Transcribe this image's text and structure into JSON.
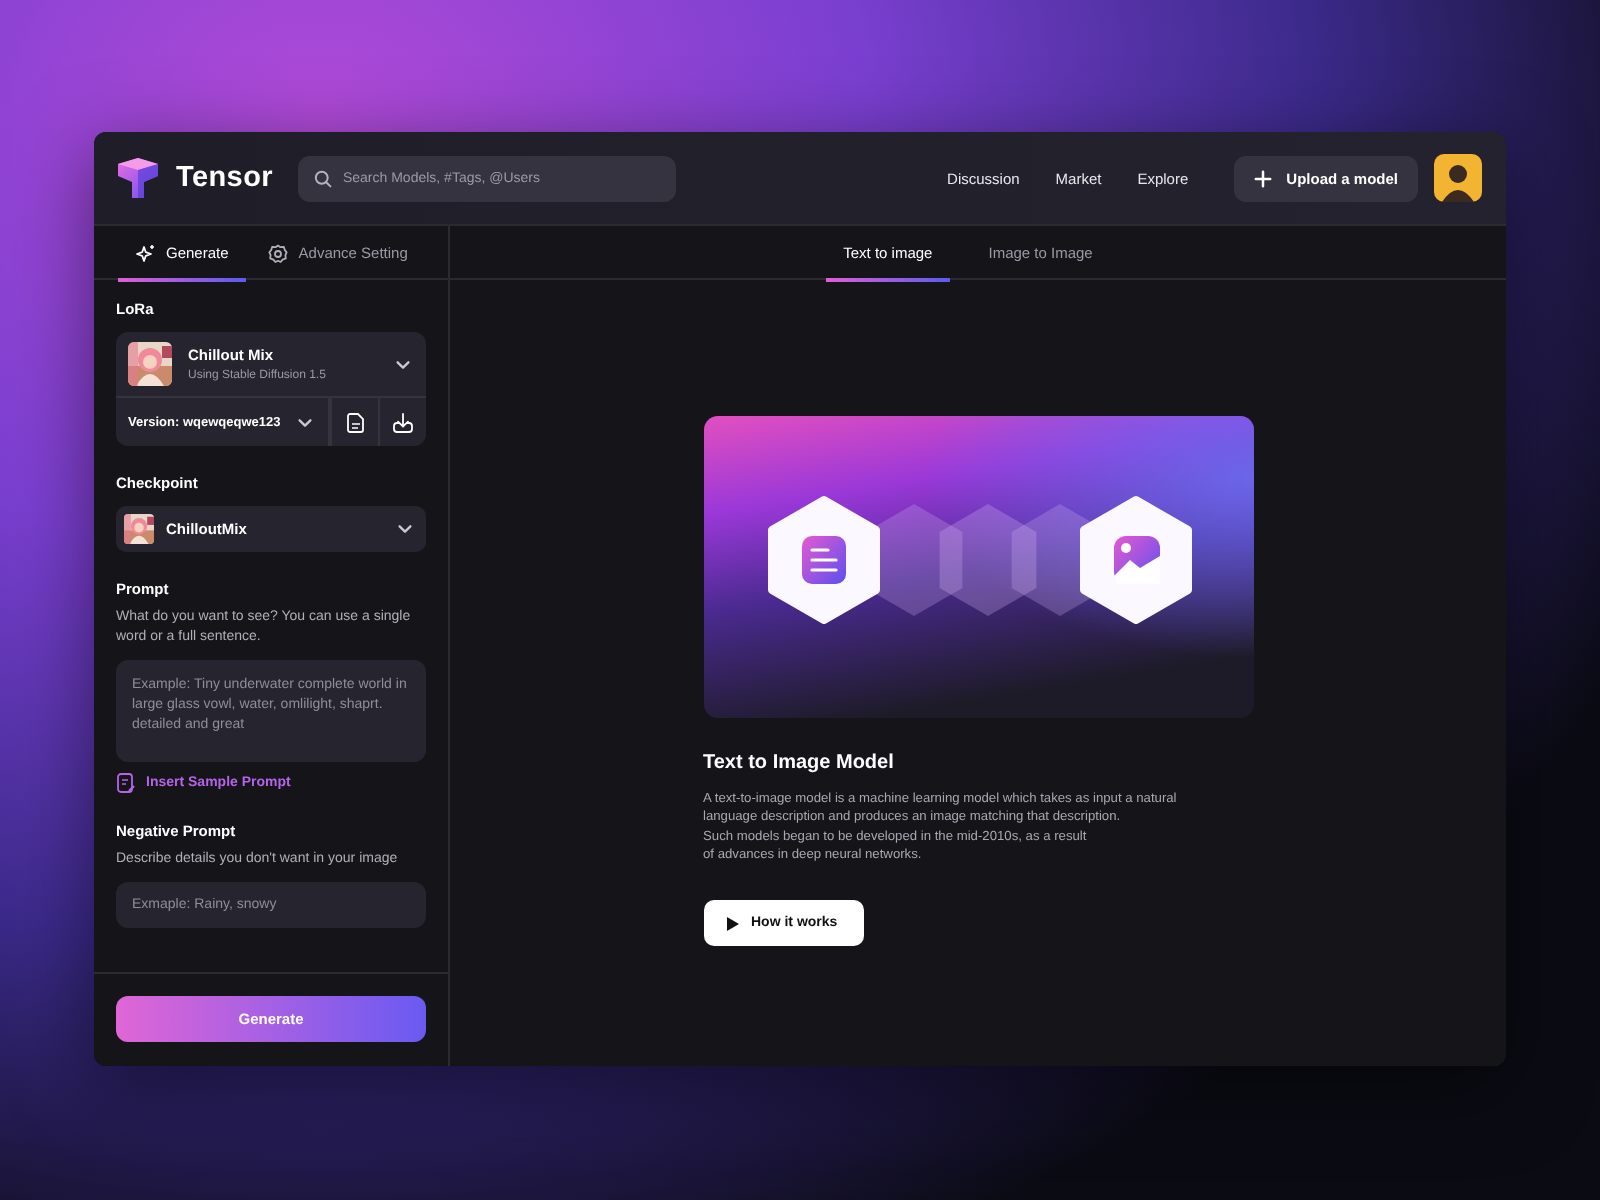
{
  "header": {
    "logo": "Tensor",
    "search": {
      "placeholder": "Search Models, #Tags, @Users"
    },
    "nav": [
      "Discussion",
      "Market",
      "Explore"
    ],
    "upload_button": "Upload a model"
  },
  "sidebar": {
    "tabs": [
      {
        "label": "Generate",
        "selected": true
      },
      {
        "label": "Advance Setting",
        "selected": false
      }
    ],
    "lora": {
      "label": "LoRa",
      "model": "Chillout Mix",
      "subtitle": "Using Stable Diffusion 1.5",
      "version": "Version: wqewqeqwe123"
    },
    "checkpoint": {
      "label": "Checkpoint",
      "value": "ChilloutMix"
    },
    "prompt": {
      "label": "Prompt",
      "help": "What do you want to see? You can use a single word or a full sentence.",
      "placeholder": "Example: Tiny underwater complete world in large glass vowl, water, omlilight, shaprt. detailed and great",
      "insert_link": "Insert Sample Prompt"
    },
    "negative_prompt": {
      "label": "Negative Prompt",
      "help": "Describe details you don't want in your image",
      "placeholder": "Exmaple: Rainy, snowy"
    },
    "generate_button": "Generate"
  },
  "main": {
    "tabs": [
      {
        "label": "Text to image",
        "selected": true
      },
      {
        "label": "Image to Image",
        "selected": false
      }
    ],
    "title": "Text to Image Model",
    "description": "A text-to-image model is a machine learning model which takes as input a natural\nlanguage description and produces an image matching that description.\nSuch models began to be developed in the mid-2010s, as a result\n of advances in deep neural networks.",
    "button": "How it works"
  }
}
